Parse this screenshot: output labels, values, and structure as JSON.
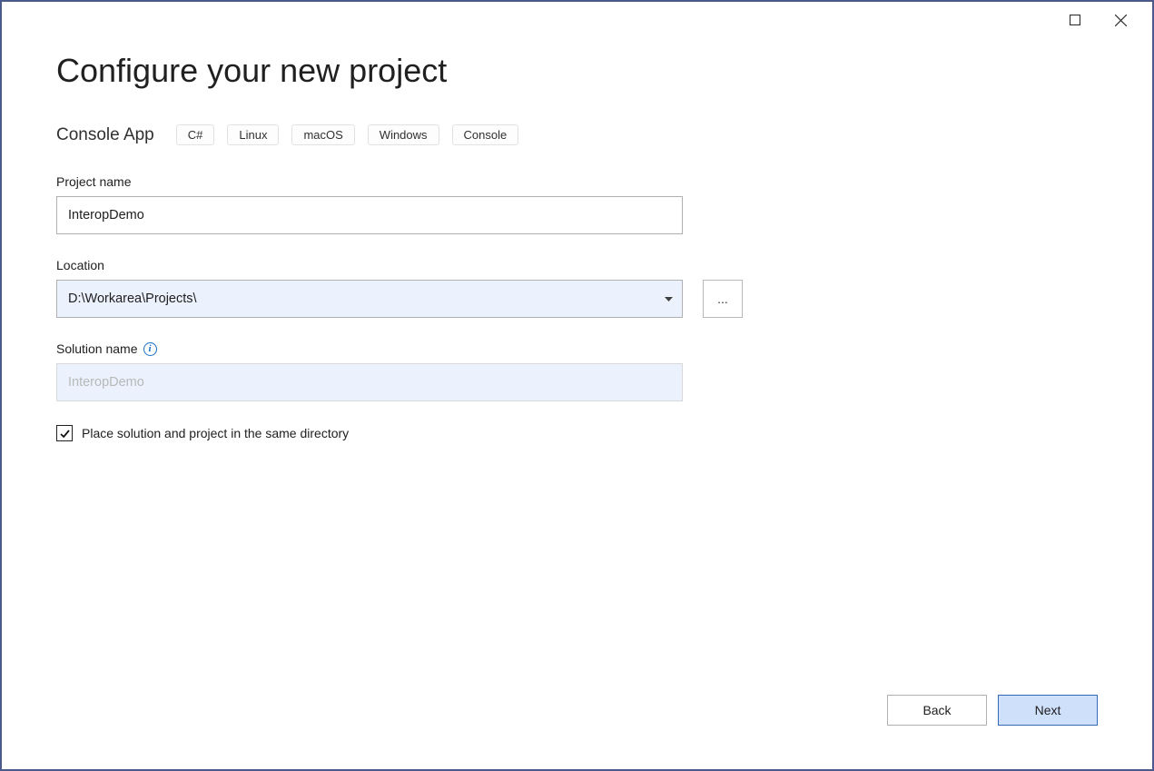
{
  "header": {
    "title": "Configure your new project"
  },
  "template": {
    "name": "Console App",
    "tags": [
      "C#",
      "Linux",
      "macOS",
      "Windows",
      "Console"
    ]
  },
  "fields": {
    "project_name": {
      "label": "Project name",
      "value": "InteropDemo"
    },
    "location": {
      "label": "Location",
      "value": "D:\\Workarea\\Projects\\",
      "browse_label": "..."
    },
    "solution_name": {
      "label": "Solution name",
      "placeholder": "InteropDemo"
    },
    "same_directory": {
      "label": "Place solution and project in the same directory",
      "checked": true
    }
  },
  "footer": {
    "back_label": "Back",
    "next_label": "Next"
  }
}
